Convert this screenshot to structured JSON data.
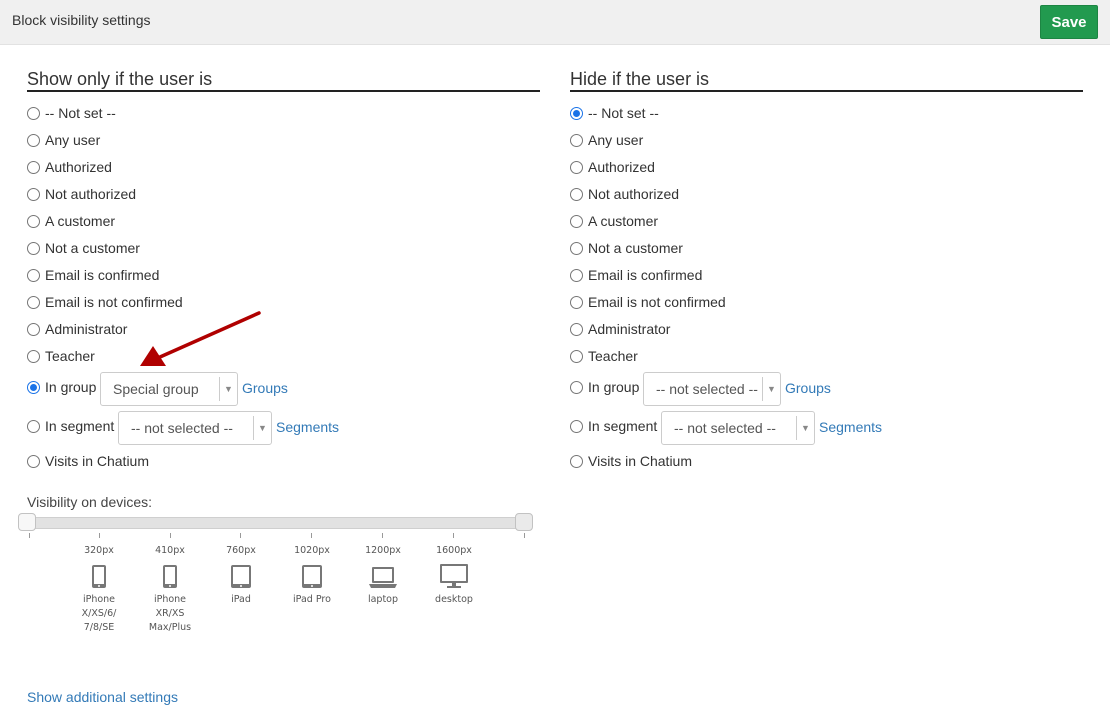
{
  "header": {
    "title": "Block visibility settings",
    "save_label": "Save"
  },
  "show_section": {
    "title": "Show only if the user is",
    "options": [
      "-- Not set --",
      "Any user",
      "Authorized",
      "Not authorized",
      "A customer",
      "Not a customer",
      "Email is confirmed",
      "Email is not confirmed",
      "Administrator",
      "Teacher"
    ],
    "in_group": {
      "label": "In group",
      "selected": "Special group",
      "link": "Groups"
    },
    "in_segment": {
      "label": "In segment",
      "selected": "-- not selected --",
      "link": "Segments"
    },
    "visits": "Visits in Chatium",
    "checked": "In group"
  },
  "hide_section": {
    "title": "Hide if the user is",
    "options": [
      "-- Not set --",
      "Any user",
      "Authorized",
      "Not authorized",
      "A customer",
      "Not a customer",
      "Email is confirmed",
      "Email is not confirmed",
      "Administrator",
      "Teacher"
    ],
    "in_group": {
      "label": "In group",
      "selected": "-- not selected --",
      "link": "Groups"
    },
    "in_segment": {
      "label": "In segment",
      "selected": "-- not selected --",
      "link": "Segments"
    },
    "visits": "Visits in Chatium",
    "checked": "-- Not set --"
  },
  "devices": {
    "label": "Visibility on devices:",
    "items": [
      {
        "px": "320px",
        "name_lines": [
          "iPhone",
          "X/XS/6/",
          "7/8/SE"
        ],
        "icon": "phone-icon"
      },
      {
        "px": "410px",
        "name_lines": [
          "iPhone",
          "XR/XS",
          "Max/Plus"
        ],
        "icon": "phone-icon"
      },
      {
        "px": "760px",
        "name_lines": [
          "iPad"
        ],
        "icon": "tablet-icon"
      },
      {
        "px": "1020px",
        "name_lines": [
          "iPad Pro"
        ],
        "icon": "tablet-icon"
      },
      {
        "px": "1200px",
        "name_lines": [
          "laptop"
        ],
        "icon": "laptop-icon"
      },
      {
        "px": "1600px",
        "name_lines": [
          "desktop"
        ],
        "icon": "desktop-icon"
      }
    ]
  },
  "footer": {
    "more_link": "Show additional settings"
  },
  "colors": {
    "save": "#229a4f",
    "link": "#337ab7",
    "radio_checked": "#1a73e8",
    "arrow": "#b00000"
  }
}
